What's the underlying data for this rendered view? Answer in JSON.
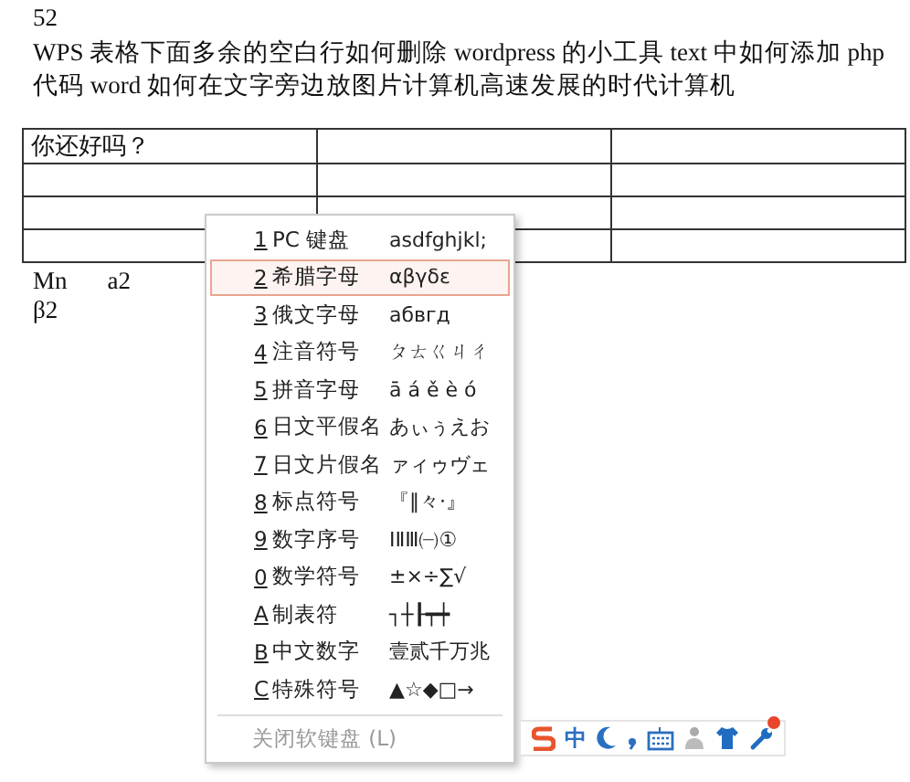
{
  "document": {
    "page_number": "52",
    "paragraph": "WPS 表格下面多余的空白行如何删除 wordpress 的小工具 text 中如何添加 php 代码 word 如何在文字旁边放图片计算机高速发展的时代计算机",
    "table": {
      "first_cell": "你还好吗？"
    },
    "lines": [
      "Mn",
      "a2",
      "β2"
    ]
  },
  "soft_keyboard_menu": {
    "items": [
      {
        "key": "1",
        "label": "PC 键盘",
        "sample": "asdfghjkl;",
        "selected": false
      },
      {
        "key": "2",
        "label": "希腊字母",
        "sample": "αβγδε",
        "selected": true
      },
      {
        "key": "3",
        "label": "俄文字母",
        "sample": "абвгд",
        "selected": false
      },
      {
        "key": "4",
        "label": "注音符号",
        "sample": "ㄆㄊㄍㄐㄔ",
        "selected": false
      },
      {
        "key": "5",
        "label": "拼音字母",
        "sample": "ā á ě è ó",
        "selected": false
      },
      {
        "key": "6",
        "label": "日文平假名",
        "sample": "あぃぅえお",
        "selected": false
      },
      {
        "key": "7",
        "label": "日文片假名",
        "sample": "ァィゥヴェ",
        "selected": false
      },
      {
        "key": "8",
        "label": "标点符号",
        "sample": "『‖々·』",
        "selected": false
      },
      {
        "key": "9",
        "label": "数字序号",
        "sample": "ⅠⅡⅢ㈠①",
        "selected": false
      },
      {
        "key": "0",
        "label": "数学符号",
        "sample": "±×÷∑√",
        "selected": false
      },
      {
        "key": "A",
        "label": "制表符",
        "sample": "┐┼┠┯┿",
        "selected": false
      },
      {
        "key": "B",
        "label": "中文数字",
        "sample": "壹贰千万兆",
        "selected": false
      },
      {
        "key": "C",
        "label": "特殊符号",
        "sample": "▲☆◆□→",
        "selected": false
      }
    ],
    "close_item": {
      "label": "关闭软键盘 (L)",
      "disabled": true
    }
  },
  "ime_toolbar": {
    "mode": "中",
    "notification": true
  }
}
